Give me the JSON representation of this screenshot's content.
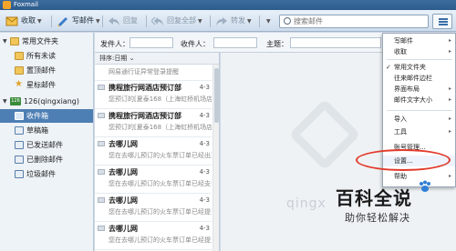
{
  "window": {
    "title": "Foxmail"
  },
  "toolbar": {
    "receive": "收取",
    "compose": "写邮件",
    "reply": "回复",
    "reply_all": "回复全部",
    "forward": "转发",
    "search_placeholder": "搜索邮件"
  },
  "sidebar": {
    "common_folders": "常用文件夹",
    "all_unread": "所有未读",
    "starred": "置顶邮件",
    "star_mail": "星标邮件",
    "account": "126(qingxiang)",
    "inbox": "收件箱",
    "drafts": "草稿箱",
    "sent": "已发送邮件",
    "deleted": "已删除邮件",
    "junk": "垃圾邮件"
  },
  "filter": {
    "sender": "发件人：",
    "recipient": "收件人：",
    "subject": "主题："
  },
  "list": {
    "sort_label": "排序:日期",
    "rows": [
      {
        "sender": "",
        "date": "",
        "snippet": "网易通行证异常登录提醒"
      },
      {
        "sender": "携程旅行网酒店预订部",
        "date": "4-3",
        "snippet": "您预订的[夏泰168（上海虹桥机场店）]"
      },
      {
        "sender": "携程旅行网酒店预订部",
        "date": "4-3",
        "snippet": "您预订的[夏泰168（上海虹桥机场店）]"
      },
      {
        "sender": "去哪儿网",
        "date": "4-3",
        "snippet": "您在去哪儿预订的火车票订单已经出票"
      },
      {
        "sender": "去哪儿网",
        "date": "4-3",
        "snippet": "您在去哪儿预订的火车票订单已经支付成功"
      },
      {
        "sender": "去哪儿网",
        "date": "4-3",
        "snippet": "您在去哪儿预订的火车票订单已经提交"
      },
      {
        "sender": "去哪儿网",
        "date": "4-3",
        "snippet": "您在去哪儿预订的火车票订单已经提交"
      }
    ]
  },
  "preview": {
    "watermark": "qingx"
  },
  "menu": {
    "items": [
      {
        "label": "写邮件",
        "check": "",
        "sub": "▸"
      },
      {
        "label": "收取",
        "check": "",
        "sub": "▸"
      },
      {
        "label": "常用文件夹",
        "check": "✓",
        "sub": ""
      },
      {
        "label": "往来邮件边栏",
        "check": "",
        "sub": ""
      },
      {
        "label": "界面布局",
        "check": "",
        "sub": "▸"
      },
      {
        "label": "邮件文字大小",
        "check": "",
        "sub": "▸"
      },
      {
        "label": "导入",
        "check": "",
        "sub": "▸"
      },
      {
        "label": "工具",
        "check": "",
        "sub": "▸"
      },
      {
        "label": "账号管理...",
        "check": "",
        "sub": ""
      },
      {
        "label": "设置...",
        "check": "",
        "sub": ""
      },
      {
        "label": "帮助",
        "check": "",
        "sub": "▸"
      }
    ]
  },
  "brand": {
    "title": "百科全说",
    "subtitle": "助你轻松解决"
  },
  "colors": {
    "accent": "#4e7fb4",
    "highlight_ring": "#e23b2c",
    "titlebar": "#2c5b8c"
  }
}
